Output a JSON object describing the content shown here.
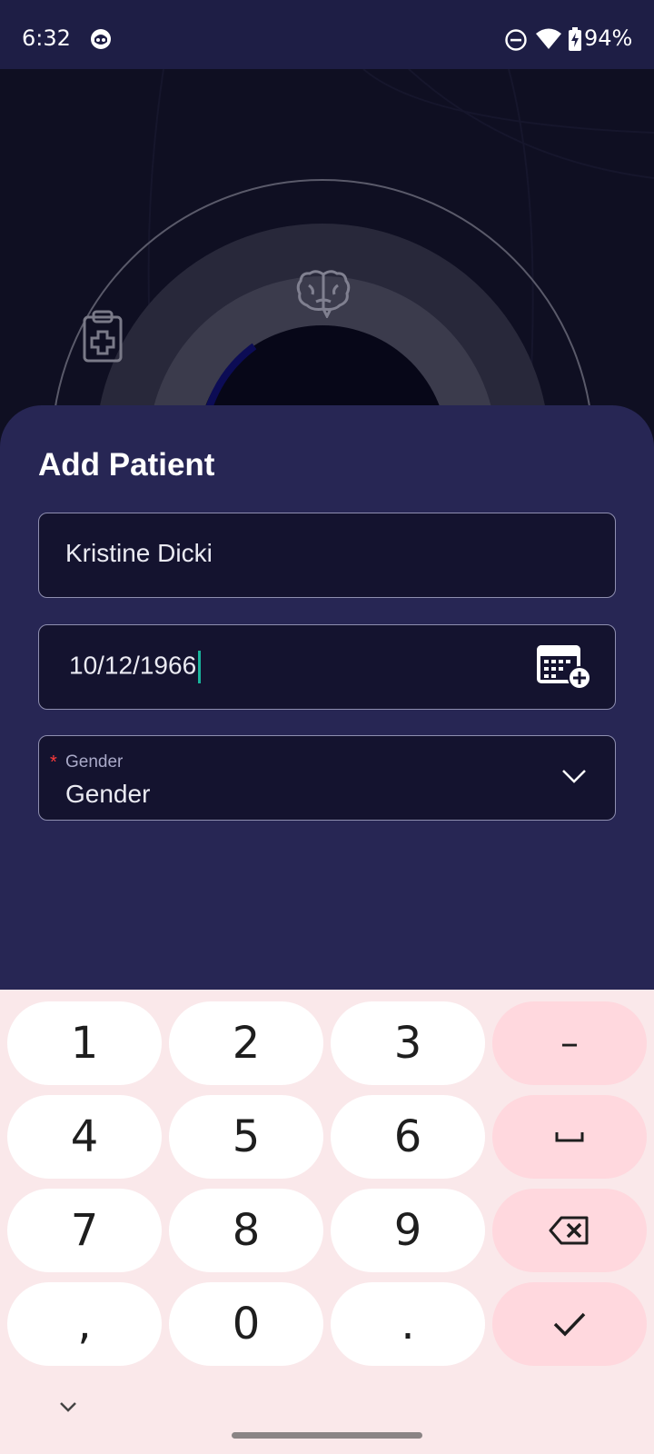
{
  "status_bar": {
    "time": "6:32",
    "battery_percent": "94%",
    "icons": [
      "app-notification-icon",
      "do-not-disturb-icon",
      "wifi-icon",
      "battery-charging-icon"
    ]
  },
  "hero": {
    "icons": [
      "clipboard-medical-icon",
      "brain-icon"
    ]
  },
  "sheet": {
    "title": "Add Patient",
    "name_field": {
      "value": "Kristine Dicki"
    },
    "dob_field": {
      "value": "10/12/1966",
      "icon": "calendar-add-icon"
    },
    "gender_field": {
      "required_mark": "*",
      "label": "Gender",
      "value": "Gender",
      "icon": "chevron-down-icon"
    }
  },
  "keyboard": {
    "keys": {
      "k1": "1",
      "k2": "2",
      "k3": "3",
      "k4": "4",
      "k5": "5",
      "k6": "6",
      "k7": "7",
      "k8": "8",
      "k9": "9",
      "comma": ",",
      "k0": "0",
      "period": ".",
      "minus": "–"
    },
    "special_keys": [
      "space-icon",
      "backspace-icon",
      "checkmark-icon",
      "keyboard-hide-icon"
    ]
  },
  "colors": {
    "status_bar": "#1e1e45",
    "sheet": "#272654",
    "field_bg": "#14132f",
    "cursor": "#19b39b",
    "required": "#ff3b3b",
    "keyboard_bg": "#fae8ea",
    "key_accent": "#ffd8de"
  }
}
